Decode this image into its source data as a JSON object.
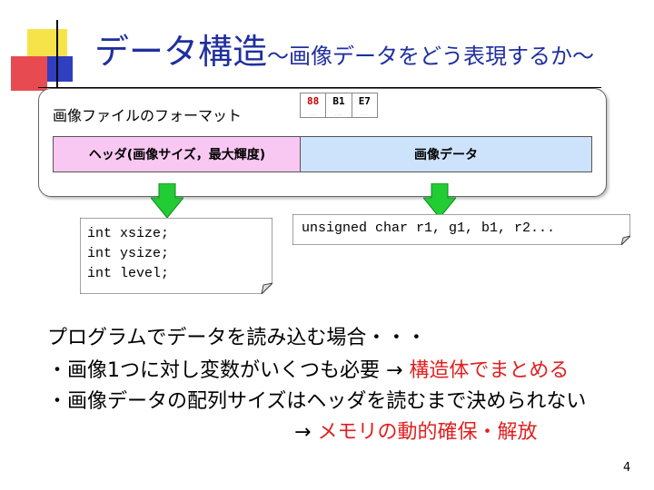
{
  "title": {
    "main": "データ構造",
    "sub": "～画像データをどう表現するか～"
  },
  "format_panel": {
    "label": "画像ファイルのフォーマット",
    "bytes": [
      {
        "hex": "88",
        "color": "#c00000"
      },
      {
        "hex": "B1",
        "color": "#000000"
      },
      {
        "hex": "E7",
        "color": "#000000"
      }
    ],
    "header_box": "ヘッダ(画像サイズ，最大輝度)",
    "image_box": "画像データ",
    "header_color": "#f8c8f2",
    "image_color": "#cde3fb"
  },
  "code_note": {
    "lines": [
      "int xsize;",
      "int ysize;",
      "int level;"
    ]
  },
  "image_note": {
    "text": "unsigned char r1, g1, b1, r2..."
  },
  "body": {
    "line1": "プログラムでデータを読み込む場合・・・",
    "line2_prefix": "・画像1つに対し変数がいくつも必要 → ",
    "line2_highlight": "構造体でまとめる",
    "line3": "・画像データの配列サイズはヘッダを読むまで決められない",
    "line4_prefix": "→ ",
    "line4_highlight": "メモリの動的確保・解放"
  },
  "page_number": "4",
  "colors": {
    "title": "#1f2f9e",
    "highlight": "#e02020",
    "arrow": "#22cc33"
  }
}
